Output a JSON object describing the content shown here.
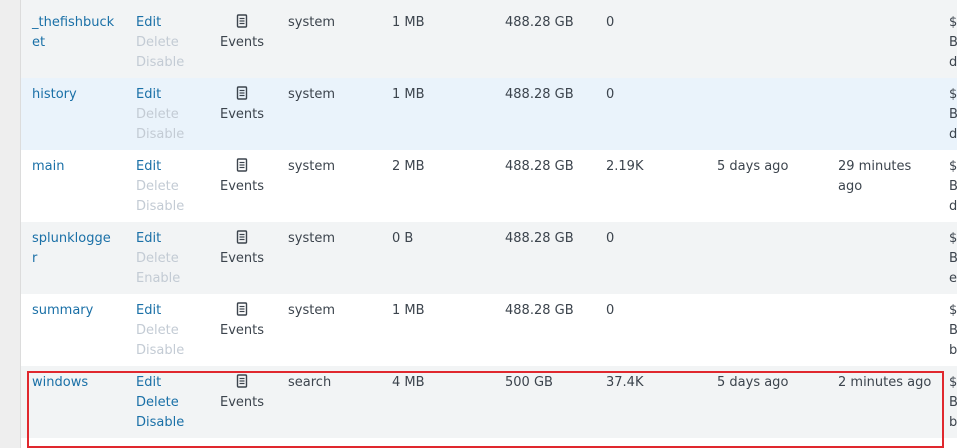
{
  "table": {
    "events_label": "Events",
    "icons": {
      "events": "document-icon"
    },
    "rows": [
      {
        "name": "_thefishbucket",
        "actions": [
          "Edit",
          "Delete",
          "Disable"
        ],
        "app": "system",
        "current_size": "1 MB",
        "max_size": "488.28 GB",
        "event_count": "0",
        "earliest_event": "",
        "latest_event": "",
        "status_fragment": [
          "$",
          "B",
          "d"
        ]
      },
      {
        "name": "history",
        "actions": [
          "Edit",
          "Delete",
          "Disable"
        ],
        "app": "system",
        "current_size": "1 MB",
        "max_size": "488.28 GB",
        "event_count": "0",
        "earliest_event": "",
        "latest_event": "",
        "status_fragment": [
          "$",
          "B",
          "d"
        ]
      },
      {
        "name": "main",
        "actions": [
          "Edit",
          "Delete",
          "Disable"
        ],
        "app": "system",
        "current_size": "2 MB",
        "max_size": "488.28 GB",
        "event_count": "2.19K",
        "earliest_event": "5 days ago",
        "latest_event": "29 minutes ago",
        "status_fragment": [
          "$",
          "B",
          "d"
        ]
      },
      {
        "name": "splunklogger",
        "actions": [
          "Edit",
          "Delete",
          "Enable"
        ],
        "app": "system",
        "current_size": "0 B",
        "max_size": "488.28 GB",
        "event_count": "0",
        "earliest_event": "",
        "latest_event": "",
        "status_fragment": [
          "$",
          "B",
          "e"
        ]
      },
      {
        "name": "summary",
        "actions": [
          "Edit",
          "Delete",
          "Disable"
        ],
        "app": "system",
        "current_size": "1 MB",
        "max_size": "488.28 GB",
        "event_count": "0",
        "earliest_event": "",
        "latest_event": "",
        "status_fragment": [
          "$",
          "B",
          "b"
        ]
      },
      {
        "name": "windows",
        "actions": [
          "Edit",
          "Delete",
          "Disable"
        ],
        "app": "search",
        "current_size": "4 MB",
        "max_size": "500 GB",
        "event_count": "37.4K",
        "earliest_event": "5 days ago",
        "latest_event": "2 minutes ago",
        "status_fragment": [
          "$",
          "B",
          "b"
        ]
      }
    ]
  },
  "colors": {
    "link": "#1a70a7",
    "disabled_link": "#c3cbd4",
    "text": "#3c444d",
    "row_alt": "#f2f4f5",
    "row_hover": "#eaf3fb",
    "highlight_border": "#e0282e"
  }
}
